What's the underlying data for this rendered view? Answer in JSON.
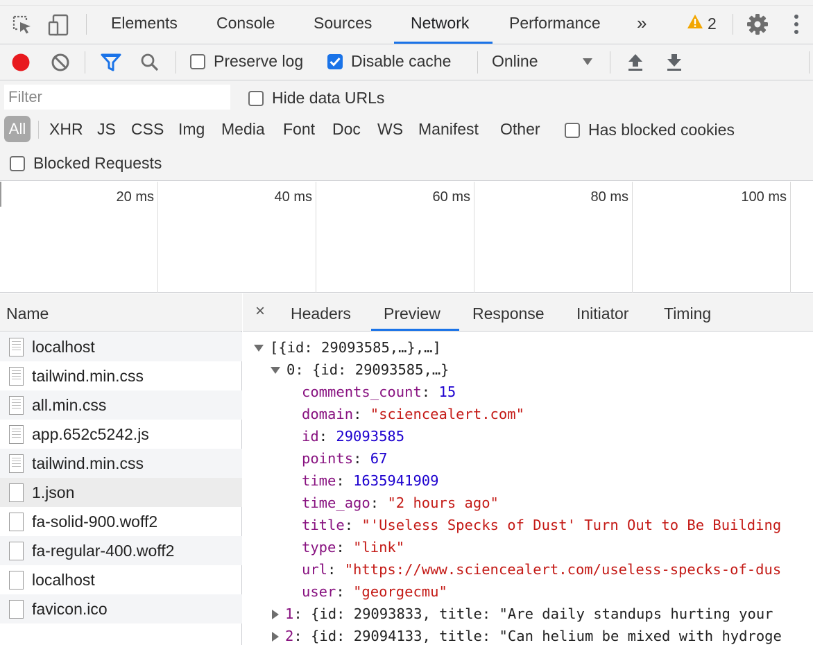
{
  "devtools": {
    "tabs": [
      "Elements",
      "Console",
      "Sources",
      "Network",
      "Performance"
    ],
    "active_tab": "Network",
    "more_tabs_label": "»",
    "warning_count": "2",
    "icons": [
      "inspect-icon",
      "device-toolbar-icon",
      "warning-icon",
      "gear-icon",
      "more-vert-icon"
    ]
  },
  "toolbar": {
    "preserve_log": {
      "label": "Preserve log",
      "checked": false
    },
    "disable_cache": {
      "label": "Disable cache",
      "checked": true
    },
    "throttling": "Online",
    "colors": {
      "record": "#e8191e",
      "filter": "#1a73e8",
      "checkbox": "#1a73e8"
    }
  },
  "filters": {
    "placeholder": "Filter",
    "hide_data_urls": "Hide data URLs",
    "types": [
      "All",
      "XHR",
      "JS",
      "CSS",
      "Img",
      "Media",
      "Font",
      "Doc",
      "WS",
      "Manifest",
      "Other"
    ],
    "active_type": "All",
    "has_blocked_cookies": "Has blocked cookies",
    "blocked_requests": "Blocked Requests"
  },
  "overview": {
    "labels": [
      "20 ms",
      "40 ms",
      "60 ms",
      "80 ms",
      "100 ms"
    ]
  },
  "requests": {
    "header": "Name",
    "items": [
      "localhost",
      "tailwind.min.css",
      "all.min.css",
      "app.652c5242.js",
      "tailwind.min.css",
      "1.json",
      "fa-solid-900.woff2",
      "fa-regular-400.woff2",
      "localhost",
      "favicon.ico"
    ],
    "selected": "1.json"
  },
  "detail": {
    "close_label": "×",
    "tabs": [
      "Headers",
      "Preview",
      "Response",
      "Initiator",
      "Timing"
    ],
    "active_tab": "Preview",
    "preview": {
      "root": "[{id: 29093585,…},…]",
      "item0_summary": "0: {id: 29093585,…}",
      "fields": [
        {
          "key": "comments_count",
          "value": "15",
          "kind": "number"
        },
        {
          "key": "domain",
          "value": "\"sciencealert.com\"",
          "kind": "string"
        },
        {
          "key": "id",
          "value": "29093585",
          "kind": "number"
        },
        {
          "key": "points",
          "value": "67",
          "kind": "number"
        },
        {
          "key": "time",
          "value": "1635941909",
          "kind": "number"
        },
        {
          "key": "time_ago",
          "value": "\"2 hours ago\"",
          "kind": "string"
        },
        {
          "key": "title",
          "value": "\"'Useless Specks of Dust' Turn Out to Be Building",
          "kind": "string"
        },
        {
          "key": "type",
          "value": "\"link\"",
          "kind": "string"
        },
        {
          "key": "url",
          "value": "\"https://www.sciencealert.com/useless-specks-of-dus",
          "kind": "string"
        },
        {
          "key": "user",
          "value": "\"georgecmu\"",
          "kind": "string"
        }
      ],
      "collapsed": [
        {
          "index": "1",
          "summary": "{id: 29093833, title: \"Are daily standups hurting your"
        },
        {
          "index": "2",
          "summary": "{id: 29094133, title: \"Can helium be mixed with hydroge"
        }
      ]
    }
  }
}
